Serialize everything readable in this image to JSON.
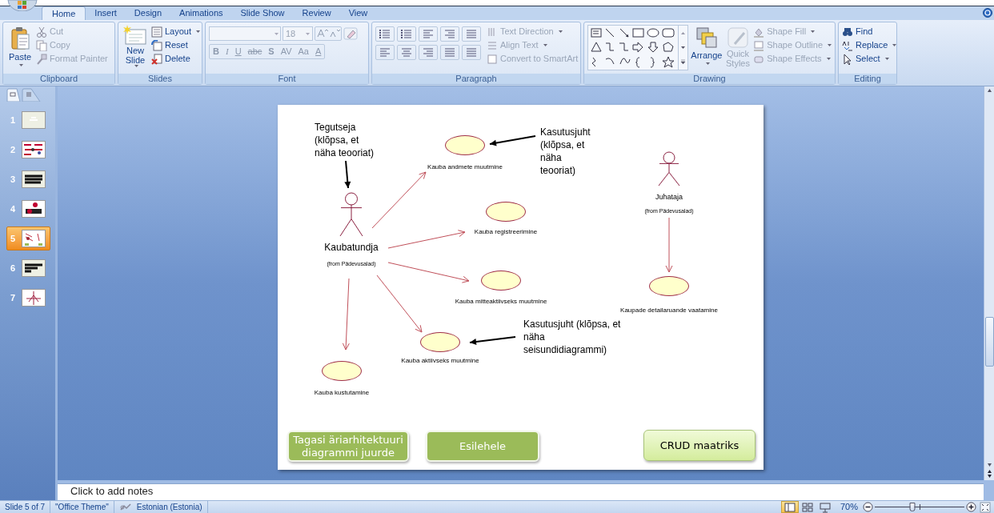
{
  "ribbon": {
    "tabs": [
      {
        "label": "Home",
        "selected": true
      },
      {
        "label": "Insert",
        "selected": false
      },
      {
        "label": "Design",
        "selected": false
      },
      {
        "label": "Animations",
        "selected": false
      },
      {
        "label": "Slide Show",
        "selected": false
      },
      {
        "label": "Review",
        "selected": false
      },
      {
        "label": "View",
        "selected": false
      }
    ],
    "clipboard": {
      "title": "Clipboard",
      "paste": "Paste",
      "items": [
        {
          "label": "Cut",
          "disabled": true
        },
        {
          "label": "Copy",
          "disabled": true
        },
        {
          "label": "Format Painter",
          "disabled": true
        }
      ]
    },
    "slides": {
      "title": "Slides",
      "new_slide": "New Slide",
      "items": [
        {
          "label": "Layout",
          "dropdown": true
        },
        {
          "label": "Reset",
          "dropdown": false
        },
        {
          "label": "Delete",
          "dropdown": false
        }
      ]
    },
    "font": {
      "title": "Font",
      "disabled": true,
      "size": "18",
      "buttons": [
        "B",
        "I",
        "U",
        "abc",
        "S",
        "AV",
        "Aa",
        "A"
      ]
    },
    "paragraph": {
      "title": "Paragraph",
      "items": [
        {
          "label": "Text Direction",
          "disabled": true
        },
        {
          "label": "Align Text",
          "disabled": true
        },
        {
          "label": "Convert to SmartArt",
          "disabled": true
        }
      ]
    },
    "drawing": {
      "title": "Drawing",
      "arrange": "Arrange",
      "quick_styles": "Quick Styles",
      "items": [
        {
          "label": "Shape Fill",
          "disabled": true
        },
        {
          "label": "Shape Outline",
          "disabled": true
        },
        {
          "label": "Shape Effects",
          "disabled": true
        }
      ]
    },
    "editing": {
      "title": "Editing",
      "items": [
        {
          "label": "Find",
          "dropdown": false
        },
        {
          "label": "Replace",
          "dropdown": true
        },
        {
          "label": "Select",
          "dropdown": true
        }
      ]
    }
  },
  "slide_pane": {
    "thumbnails": [
      {
        "number": "1",
        "selected": false
      },
      {
        "number": "2",
        "selected": false
      },
      {
        "number": "3",
        "selected": false
      },
      {
        "number": "4",
        "selected": false
      },
      {
        "number": "5",
        "selected": true
      },
      {
        "number": "6",
        "selected": false
      },
      {
        "number": "7",
        "selected": false
      }
    ]
  },
  "slide": {
    "actors": [
      {
        "name": "Kaubatundja",
        "package": "(from Pädevusalad)"
      },
      {
        "name": "Juhataja",
        "package": "(from Pädevusalad)"
      }
    ],
    "use_cases": [
      "Kauba andmete muutmine",
      "Kauba registreerimine",
      "Kauba mitteaktiivseks muutmine",
      "Kauba aktiivseks muutmine",
      "Kauba kustutamine",
      "Kaupade detailaruande vaatamine"
    ],
    "callouts": [
      "Tegutseja (klõpsa, et näha teooriat)",
      "Kasutusjuht (klõpsa, et näha teooriat)",
      "Kasutusjuht (klõpsa, et näha seisundidiagrammi)"
    ],
    "buttons": [
      {
        "label": "Tagasi äriarhitektuuri diagrammi juurde",
        "kind": "dark"
      },
      {
        "label": "Esilehele",
        "kind": "dark"
      },
      {
        "label": "CRUD maatriks",
        "kind": "light"
      }
    ]
  },
  "notes": {
    "placeholder": "Click to add notes"
  },
  "status_bar": {
    "slide": "Slide 5 of 7",
    "theme": "\"Office Theme\"",
    "language": "Estonian (Estonia)",
    "views": [
      {
        "kind": "normal",
        "selected": true
      },
      {
        "kind": "sorter",
        "selected": false
      },
      {
        "kind": "show",
        "selected": false
      }
    ],
    "zoom": "70%",
    "level": 0.42
  }
}
